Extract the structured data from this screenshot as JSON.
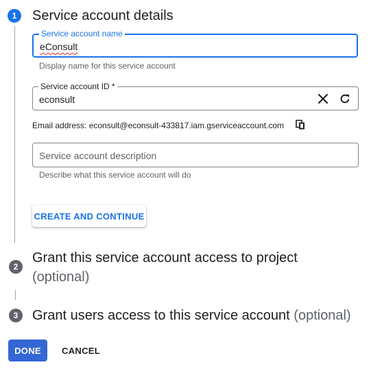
{
  "colors": {
    "accent": "#1a73e8",
    "step_active": "#1a73e8",
    "step_inactive": "#5f6368",
    "done_button": "#3367d6"
  },
  "steps": [
    {
      "number": "1",
      "title": "Service account details",
      "optional": ""
    },
    {
      "number": "2",
      "title": "Grant this service account access to project",
      "optional": "(optional)"
    },
    {
      "number": "3",
      "title": "Grant users access to this service account",
      "optional": "(optional)"
    }
  ],
  "form": {
    "name_field": {
      "label": "Service account name",
      "value": "eConsult",
      "hint": "Display name for this service account"
    },
    "id_field": {
      "label": "Service account ID *",
      "value": "econsult",
      "clear_icon": "close-icon",
      "refresh_icon": "refresh-icon"
    },
    "email": {
      "text": "Email address: econsult@econsult-433817.iam.gserviceaccount.com",
      "copy_icon": "copy-icon"
    },
    "description_field": {
      "placeholder": "Service account description",
      "hint": "Describe what this service account will do"
    },
    "create_button": "CREATE AND CONTINUE"
  },
  "footer": {
    "done_label": "DONE",
    "cancel_label": "CANCEL"
  }
}
